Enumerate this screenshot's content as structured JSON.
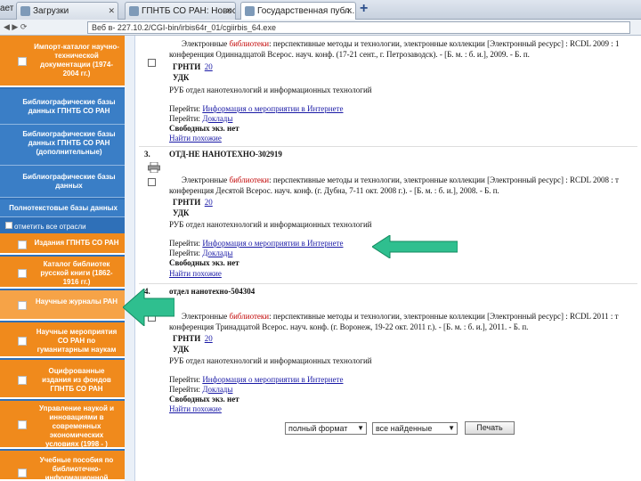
{
  "browser": {
    "tabs": [
      "Загрузки",
      "ГПНТБ СО РАН: Новосибирск",
      "Государственная публ..."
    ],
    "left_fragment": "ает",
    "address": "Веб  в- 227.10.2/CGI-bin/irbis64r_01/cgiirbis_64.exe",
    "new_tab": "+"
  },
  "sidebar": {
    "items": [
      {
        "label": "Импорт-каталог научно-технической документации (1974-2004 гг.)",
        "style": "orange"
      },
      {
        "label": "Библиографические базы данных ГПНТБ СО РАН",
        "style": "blue"
      },
      {
        "label": "Библиографические базы данных ГПНТБ СО РАН (дополнительные)",
        "style": "blue"
      },
      {
        "label": "Библиографические базы данных",
        "style": "blue"
      },
      {
        "label": "Полнотекстовые базы данных",
        "style": "blue"
      },
      {
        "label": "отметить все отрасли",
        "style": "blue"
      },
      {
        "label": "Издания ГПНТБ СО РАН",
        "style": "orange"
      },
      {
        "label": "Каталог библиотек русской книги (1862-1916 гг.)",
        "style": "orange"
      },
      {
        "label": "Научные журналы РАН",
        "style": "orange"
      },
      {
        "label": "Научные мероприятия СО РАН по гуманитарным наукам",
        "style": "orange"
      },
      {
        "label": "Оцифрованные издания из фондов ГПНТБ СО РАН",
        "style": "orange"
      },
      {
        "label": "Управление наукой и инновациями в современных экономических условиях (1998 - )",
        "style": "orange"
      },
      {
        "label": "Учебные пособия по библиотечно-информационной",
        "style": "orange"
      }
    ]
  },
  "records": {
    "r1": {
      "desc1_a": "Электронные ",
      "desc1_hi": "библиотеки",
      "desc1_b": ": перспективные методы и технологии, электронные коллекции [Электронный ресурс] : RCDL 2009 : 1",
      "desc2": "конференция Одиннадцатой Всерос. науч. конф. (17-21 сент., г. Петрозаводск). - [Б. м. : б. и.], 2009. - Б. п.",
      "grnti_label": "ГРНТИ",
      "grnti_val": "20",
      "udk_label": "УДК",
      "rub": "РУБ отдел нанотехнологий и информационных технологий",
      "goto1_label": "Перейти: ",
      "goto1_link": "Информация о мероприятии в Интернете",
      "goto2_label": "Перейти: ",
      "goto2_link": "Доклады",
      "free": "Свободных экз. нет",
      "find": "Найти похожие"
    },
    "r3": {
      "num": "3.",
      "code": "ОТД-НЕ НАНОТЕХНО-302919",
      "desc1_a": "Электронные ",
      "desc1_hi": "библиотеки",
      "desc1_b": ": перспективные методы и технологии, электронные коллекции [Электронный ресурс] : RCDL 2008 : т",
      "desc2": "конференция Десятой Всерос. науч. конф. (г. Дубна, 7-11 окт. 2008 г.). - [Б. м. : б. и.], 2008. - Б. п.",
      "grnti_label": "ГРНТИ",
      "grnti_val": "20",
      "udk_label": "УДК",
      "rub": "РУБ отдел нанотехнологий и информационных технологий",
      "goto1_label": "Перейти: ",
      "goto1_link": "Информация о мероприятии в Интернете",
      "goto2_label": "Перейти: ",
      "goto2_link": "Доклады",
      "free": "Свободных экз. нет",
      "find": "Найти похожие"
    },
    "r4": {
      "num": "4.",
      "code": "отдел нанотехно-504304",
      "desc1_a": "Электронные ",
      "desc1_hi": "библиотеки",
      "desc1_b": ": перспективные методы и технологии, электронные коллекции [Электронный ресурс] : RCDL 2011 : т",
      "desc2": "конференция Тринадцатой Всерос. науч. конф. (г. Воронеж, 19-22 окт. 2011 г.). - [Б. м. : б. и.], 2011. - Б. п.",
      "grnti_label": "ГРНТИ",
      "grnti_val": "20",
      "udk_label": "УДК",
      "rub": "РУБ отдел нанотехнологий и информационных технологий",
      "goto1_label": "Перейти: ",
      "goto1_link": "Информация о мероприятии в Интернете",
      "goto2_label": "Перейти: ",
      "goto2_link": "Доклады",
      "free": "Свободных экз. нет",
      "find": "Найти похожие"
    }
  },
  "controls": {
    "format": "полный формат",
    "scope": "все найденные",
    "print": "Печать"
  },
  "colors": {
    "sidebar_blue": "#2f70b8",
    "sidebar_orange": "#f08a1c",
    "highlight": "#c00000",
    "arrow_fill": "#2fbf8f"
  }
}
